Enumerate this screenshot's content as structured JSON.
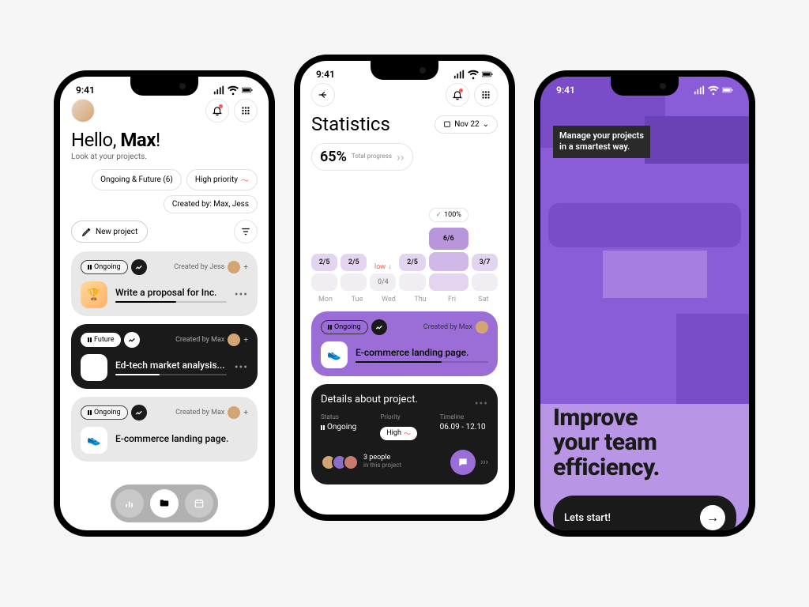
{
  "status_time": "9:41",
  "screen1": {
    "greeting_prefix": "Hello, ",
    "greeting_name": "Max",
    "greeting_suffix": "!",
    "subtitle": "Look at your projects.",
    "chips": {
      "ongoing": "Ongoing & Future (6)",
      "priority": "High priority",
      "created": "Created by: Max, Jess"
    },
    "new_project": "New project",
    "cards": [
      {
        "status": "Ongoing",
        "meta": "Created by Jess",
        "title": "Write a proposal for Inc."
      },
      {
        "status": "Future",
        "meta": "Created by Max",
        "title": "Ed-tech market analysis..."
      },
      {
        "status": "Ongoing",
        "meta": "Created by Max",
        "title": "E-commerce landing page."
      }
    ]
  },
  "screen2": {
    "title": "Statistics",
    "date": "Nov 22",
    "progress_pct": "65%",
    "progress_label": "Total progress",
    "peak_label": "100%",
    "low_label": "low",
    "days": [
      "Mon",
      "Tue",
      "Wed",
      "Thu",
      "Fri",
      "Sat"
    ],
    "selected": {
      "status": "Ongoing",
      "meta": "Created by Max",
      "title": "E-commerce landing page."
    },
    "details": {
      "title": "Details about project.",
      "status_label": "Status",
      "status_val": "Ongoing",
      "priority_label": "Priority",
      "priority_val": "High",
      "timeline_label": "Timeline",
      "timeline_val": "06.09 - 12.10",
      "people_count": "3 people",
      "people_sub": "in this project"
    }
  },
  "chart_data": {
    "type": "bar",
    "categories": [
      "Mon",
      "Tue",
      "Wed",
      "Thu",
      "Fri",
      "Sat"
    ],
    "series": [
      {
        "name": "tasks",
        "values": [
          "2/5",
          "2/5",
          "0/4",
          "2/5",
          "6/6",
          "3/7"
        ]
      }
    ],
    "peak": {
      "day": "Fri",
      "label": "100%"
    },
    "low_marker": {
      "day": "Wed",
      "label": "low"
    }
  },
  "screen3": {
    "tagline_l1": "Manage your projects",
    "tagline_l2": "in a smartest way.",
    "hero_l1": "Improve",
    "hero_l2": "your team",
    "hero_l3": "efficiency.",
    "start": "Lets start!"
  }
}
